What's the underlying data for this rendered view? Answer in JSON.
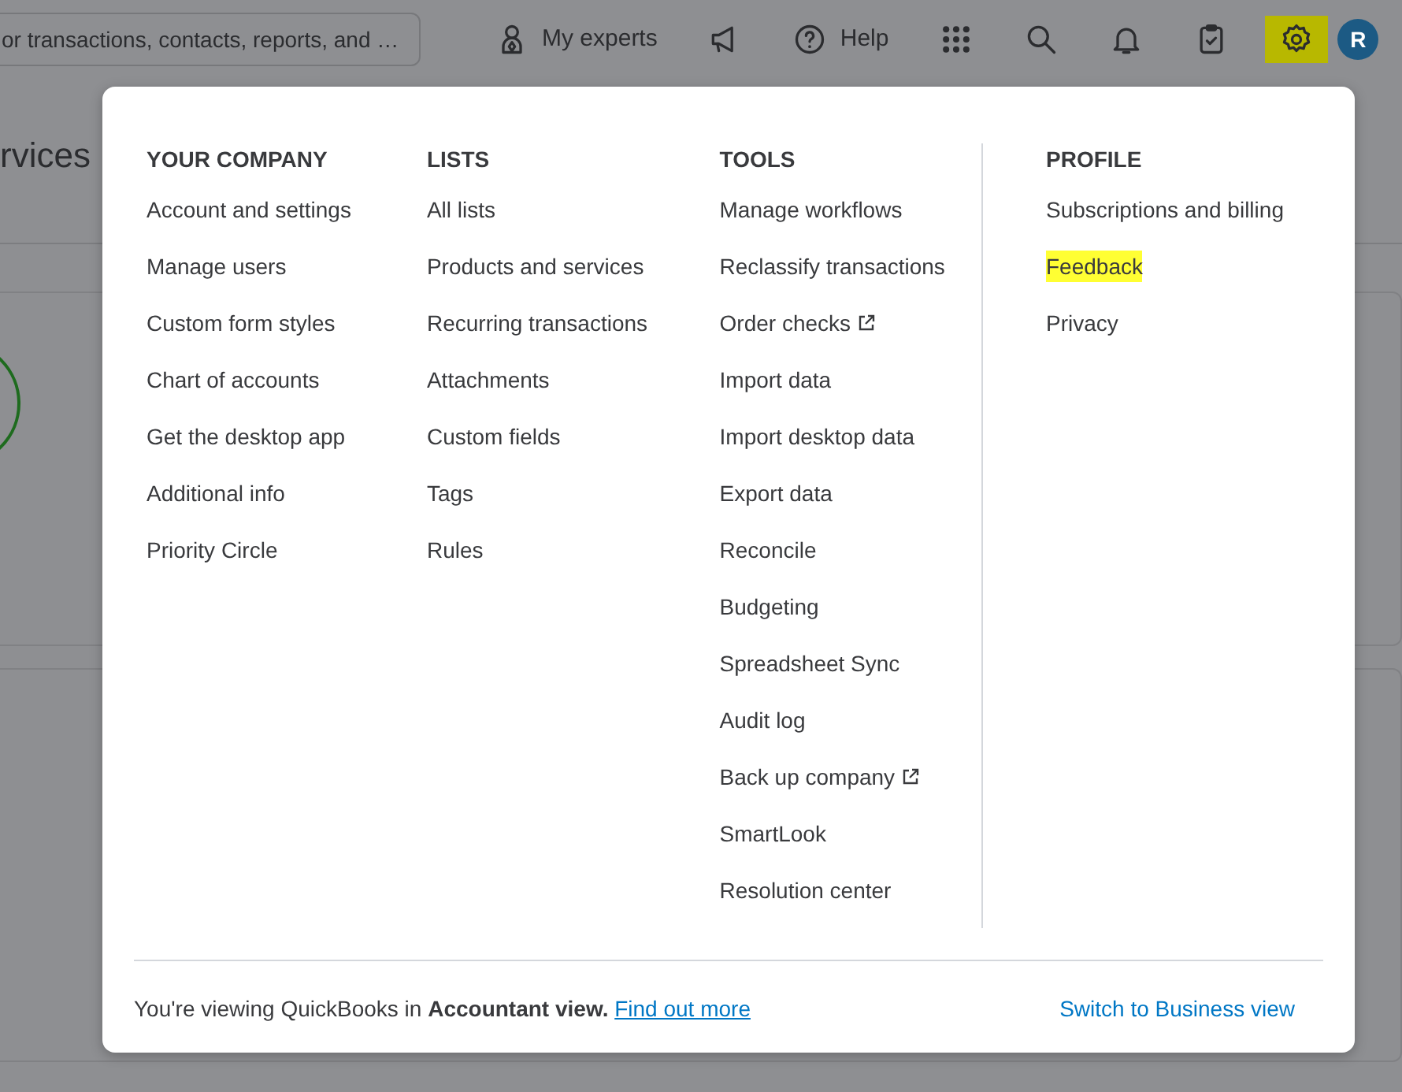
{
  "header": {
    "search": {
      "placeholder": "or transactions, contacts, reports, and …"
    },
    "toolbar": [
      {
        "kind": "experts",
        "label": "My experts",
        "highlighted": false
      },
      {
        "kind": "announcements",
        "highlighted": false
      },
      {
        "kind": "help",
        "label": "Help",
        "highlighted": false
      },
      {
        "kind": "apps",
        "highlighted": false
      },
      {
        "kind": "search",
        "highlighted": false
      },
      {
        "kind": "notifications",
        "highlighted": false
      },
      {
        "kind": "tasks",
        "highlighted": false
      },
      {
        "kind": "settings",
        "highlighted": true
      }
    ],
    "avatar": {
      "initial": "R"
    }
  },
  "page": {
    "heading": "rvices"
  },
  "settings_menu": {
    "columns": [
      {
        "title": "YOUR COMPANY",
        "items": [
          {
            "label": "Account and settings",
            "external": false,
            "highlighted": false
          },
          {
            "label": "Manage users",
            "external": false,
            "highlighted": false
          },
          {
            "label": "Custom form styles",
            "external": false,
            "highlighted": false
          },
          {
            "label": "Chart of accounts",
            "external": false,
            "highlighted": false
          },
          {
            "label": "Get the desktop app",
            "external": false,
            "highlighted": false
          },
          {
            "label": "Additional info",
            "external": false,
            "highlighted": false
          },
          {
            "label": "Priority Circle",
            "external": false,
            "highlighted": false
          }
        ]
      },
      {
        "title": "LISTS",
        "items": [
          {
            "label": "All lists",
            "external": false,
            "highlighted": false
          },
          {
            "label": "Products and services",
            "external": false,
            "highlighted": false
          },
          {
            "label": "Recurring transactions",
            "external": false,
            "highlighted": false
          },
          {
            "label": "Attachments",
            "external": false,
            "highlighted": false
          },
          {
            "label": "Custom fields",
            "external": false,
            "highlighted": false
          },
          {
            "label": "Tags",
            "external": false,
            "highlighted": false
          },
          {
            "label": "Rules",
            "external": false,
            "highlighted": false
          }
        ]
      },
      {
        "title": "TOOLS",
        "items": [
          {
            "label": "Manage workflows",
            "external": false,
            "highlighted": false
          },
          {
            "label": "Reclassify transactions",
            "external": false,
            "highlighted": false
          },
          {
            "label": "Order checks",
            "external": true,
            "highlighted": false
          },
          {
            "label": "Import data",
            "external": false,
            "highlighted": false
          },
          {
            "label": "Import desktop data",
            "external": false,
            "highlighted": false
          },
          {
            "label": "Export data",
            "external": false,
            "highlighted": false
          },
          {
            "label": "Reconcile",
            "external": false,
            "highlighted": false
          },
          {
            "label": "Budgeting",
            "external": false,
            "highlighted": false
          },
          {
            "label": "Spreadsheet Sync",
            "external": false,
            "highlighted": false
          },
          {
            "label": "Audit log",
            "external": false,
            "highlighted": false
          },
          {
            "label": "Back up company",
            "external": true,
            "highlighted": false
          },
          {
            "label": "SmartLook",
            "external": false,
            "highlighted": false
          },
          {
            "label": "Resolution center",
            "external": false,
            "highlighted": false
          }
        ]
      },
      {
        "title": "PROFILE",
        "items": [
          {
            "label": "Subscriptions and billing",
            "external": false,
            "highlighted": false
          },
          {
            "label": "Feedback",
            "external": false,
            "highlighted": true
          },
          {
            "label": "Privacy",
            "external": false,
            "highlighted": false
          }
        ]
      }
    ],
    "footer": {
      "text": "You're viewing QuickBooks in **Accountant view.**",
      "link": "Find out more",
      "action": "Switch to Business view"
    }
  }
}
